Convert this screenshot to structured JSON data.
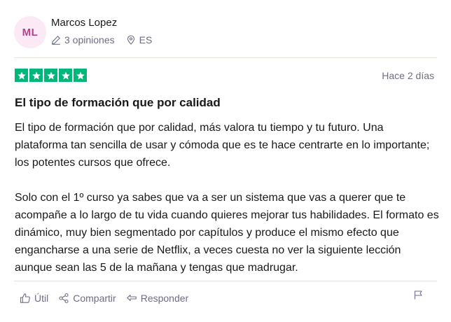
{
  "reviewer": {
    "initials": "ML",
    "name": "Marcos Lopez",
    "reviews_count": "3 opiniones",
    "country": "ES",
    "avatar_bg": "#fbeaf6",
    "avatar_color": "#b5418e"
  },
  "review": {
    "rating": 5,
    "max_rating": 5,
    "star_color": "#00b67a",
    "date": "Hace 2 días",
    "title": "El tipo de formación que por calidad",
    "paragraphs": [
      "El tipo de formación que por calidad, más valora tu tiempo y tu futuro. Una plataforma tan sencilla de usar y cómoda que es te hace centrarte en lo importante; los potentes cursos que ofrece.",
      "Solo con el 1º curso ya sabes que va a ser un sistema que vas a querer que te acompañe a lo largo de tu vida cuando quieres mejorar tus habilidades. El formato es dinámico, muy bien segmentado por capítulos y produce el mismo efecto que engancharse a una serie de Netflix, a veces cuesta no ver la siguiente lección aunque sean las 5 de la mañana y tengas que madrugar."
    ]
  },
  "actions": {
    "useful_label": "Útil",
    "share_label": "Compartir",
    "reply_label": "Responder",
    "useful_icon": "thumbs-up-icon",
    "share_icon": "share-icon",
    "reply_icon": "reply-icon",
    "flag_icon": "flag-icon"
  }
}
